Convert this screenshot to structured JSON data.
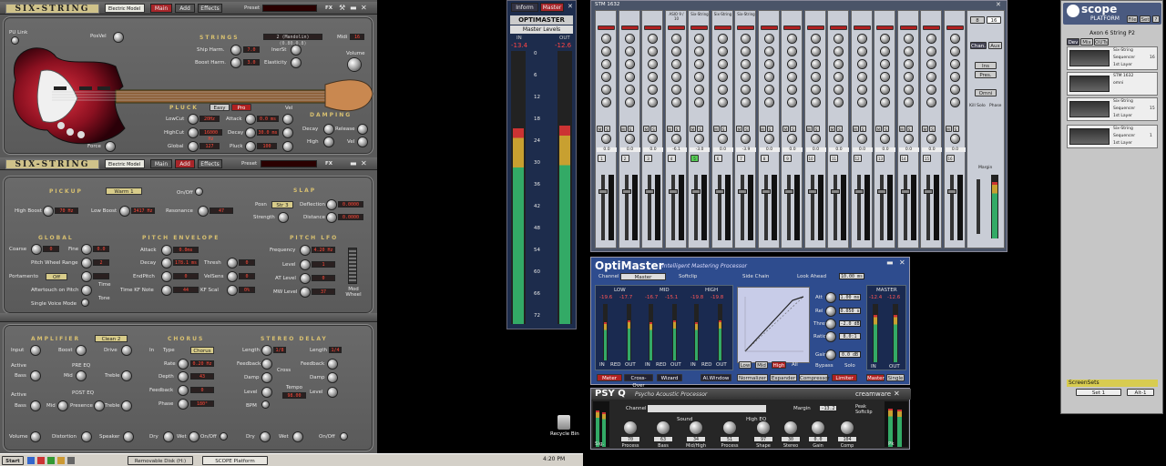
{
  "six": {
    "logo": "SIX-STRING",
    "preset_label": "Preset",
    "preset_name": "Electric Model",
    "tabs": [
      "Main",
      "Add",
      "Effects"
    ],
    "fx": "FX",
    "pu_link": "PU Link",
    "posvel": "PosVel",
    "strings_title": "STRINGS",
    "strings_preset": "2 (Mandolin) (0.80.0.8)",
    "midi": "Midi",
    "midi_val": "16",
    "ship_harm": "Ship Harm.",
    "ship_val": "7.0",
    "inertia": "InerSt",
    "boost_harm": "Boost Harm.",
    "boost_val": "3.0",
    "elasticity": "Elasticity",
    "volume": "Volume",
    "pluck_title": "PLUCK",
    "easy": "Easy",
    "pro": "Pro",
    "damping_title": "DAMPING",
    "vel": "Vel",
    "lowcut": "LowCut",
    "lowcut_val": "20Hz",
    "attack": "Attack",
    "attack_val": "0.0 ms",
    "decay": "Decay",
    "release": "Release",
    "highcut": "HighCut",
    "highcut_val": "16000 Hz",
    "decay2": "Decay",
    "decay2_val": "30.0 ms",
    "high": "High",
    "vel2": "Vel",
    "global": "Global",
    "global_val": "127",
    "pluck": "Pluck",
    "pluck_val": "100",
    "force": "Force"
  },
  "six2": {
    "preset_name": "Electric Model",
    "tabs": [
      "Main",
      "Add",
      "Effects"
    ],
    "preset_label": "Preset",
    "fx": "FX",
    "pickup": "PICKUP",
    "pickup_sel": "Warm 1",
    "onoff": "On/Off",
    "high_boost": "High Boost",
    "hb_val": "70 Hz",
    "low_boost": "Low Boost",
    "lb_val": "3417 Hz",
    "resonance": "Resonance",
    "res_val": "47",
    "slap": "SLAP",
    "posn": "Posn",
    "posn_sel": "Str 3",
    "deflection": "Deflection",
    "defl_val": "0.0000",
    "strength": "Strength",
    "distance": "Distance",
    "dist_val": "0.0000",
    "global": "GLOBAL",
    "coarse": "Coarse",
    "coarse_val": "0",
    "fine": "Fine",
    "fine_val": "0.0",
    "pitch_wheel": "Pitch Wheel Range",
    "pw_val": "2",
    "portamento": "Portamento",
    "porta_sel": "Off",
    "aftertouch": "Aftertouch on Pitch",
    "single_voice": "Single Voice Mode",
    "time": "Time",
    "tone": "Tone",
    "penv": "PITCH ENVELOPE",
    "attack": "Attack",
    "attack_val": "0.0ms",
    "decay": "Decay",
    "decay_val": "178.1 ms",
    "endpitch": "EndPitch",
    "end_val": "0",
    "timekf": "Time KF Note",
    "timekf_val": "44",
    "thresh": "Thresh",
    "thresh_val": "0",
    "velsens": "VelSens",
    "velsens_val": "0",
    "kfscal": "KF Scal",
    "kfscal_val": "0%",
    "plfo": "PITCH LFO",
    "freq": "Frequency",
    "freq_val": "4.20 Hz",
    "level": "Level",
    "level_val": "1",
    "at_level": "AT Level",
    "at_val": "0",
    "mw_level": "MW Level",
    "mw_val": "37",
    "mod_wheel": "Mod Wheel"
  },
  "six3": {
    "amp": "AMPLIFIER",
    "amp_sel": "Clean 2",
    "input": "Input",
    "boost": "Boost",
    "drive": "Drive",
    "active": "Active",
    "pre_eq": "PRE EQ",
    "bass": "Bass",
    "mid": "Mid",
    "treble": "Treble",
    "post_eq": "POST EQ",
    "presence": "Presence",
    "volume": "Volume",
    "distortion": "Distortion",
    "speaker": "Speaker",
    "chorus": "CHORUS",
    "in": "In",
    "type": "Type",
    "type_sel": "Chorus",
    "rate": "Rate",
    "rate_val": "0.20 Hz",
    "depth": "Depth",
    "depth_val": "43",
    "feedback": "Feedback",
    "fb_val": "0",
    "phase": "Phase",
    "phase_val": "180°",
    "dry": "Dry",
    "wet": "Wet",
    "onoff": "On/Off",
    "delay": "STEREO DELAY",
    "length": "Length",
    "len_val": "1/8",
    "length2": "Length",
    "len2_val": "1/4",
    "cross": "Cross",
    "fb": "Feedback",
    "fb2": "Feedback",
    "damp": "Damp",
    "damp2": "Damp",
    "lvl": "Level",
    "lvl2": "Level",
    "tempo": "Tempo",
    "tempo_val": "98.00",
    "bpm": "BPM"
  },
  "opti": {
    "tabs": [
      "Inform",
      "Master"
    ],
    "title": "OPTIMASTER",
    "sub": "Master Levels",
    "in": "IN",
    "out": "OUT",
    "in_val": "-13.4",
    "out_val": "-12.6",
    "scale": [
      "0",
      "6",
      "12",
      "18",
      "24",
      "30",
      "36",
      "42",
      "48",
      "54",
      "60",
      "66",
      "72"
    ]
  },
  "stm": {
    "title": "STM 1632",
    "strips": [
      {
        "name": "",
        "num": "1",
        "val": "0.0"
      },
      {
        "name": "",
        "num": "2",
        "val": "0.0"
      },
      {
        "name": "",
        "num": "3",
        "val": "0.0"
      },
      {
        "name": "ASIO 9 / 10",
        "num": "4",
        "val": "-6.1"
      },
      {
        "name": "Six-String",
        "num": "5",
        "val": "-3.0"
      },
      {
        "name": "Six-String",
        "num": "6",
        "val": "0.0"
      },
      {
        "name": "Six-String",
        "num": "7",
        "val": "-3.9"
      },
      {
        "name": "",
        "num": "8",
        "val": "0.0"
      },
      {
        "name": "",
        "num": "9",
        "val": "0.0"
      },
      {
        "name": "",
        "num": "10",
        "val": "0.0"
      },
      {
        "name": "",
        "num": "11",
        "val": "0.0"
      },
      {
        "name": "",
        "num": "12",
        "val": "0.0"
      },
      {
        "name": "",
        "num": "13",
        "val": "0.0"
      },
      {
        "name": "",
        "num": "14",
        "val": "0.0"
      },
      {
        "name": "",
        "num": "15",
        "val": "0.0"
      },
      {
        "name": "",
        "num": "16",
        "val": "0.0"
      }
    ],
    "aux": "Aux",
    "chan": "Chan.",
    "ins": "Ins",
    "pres": "Pres.",
    "omni": "Omni",
    "kill_solo": "Kill Solo",
    "phase": "Phase",
    "margin": "Margin",
    "buses": [
      "8",
      "16"
    ],
    "aux_vals": [
      "1",
      "2",
      "3",
      "4",
      "5",
      "6",
      "7",
      "8"
    ]
  },
  "proc": {
    "title": "OptiMaster",
    "subtitle": "Intelligent Mastering Processor",
    "channel": "Channel",
    "channel_sel": "Master",
    "softclip": "Softclip",
    "side_chain": "Side Chain",
    "look_ahead": "Look Ahead",
    "la_val": "10.00 ms",
    "bands": [
      {
        "name": "LOW",
        "l": "-19.6",
        "r": "-17.7"
      },
      {
        "name": "MID",
        "l": "-16.7",
        "r": "-15.1"
      },
      {
        "name": "HIGH",
        "l": "-19.8",
        "r": "-19.8"
      }
    ],
    "red": "RED",
    "out_lbl": "OUT",
    "in_lbl": "IN",
    "att": "Att",
    "att_val": "1.00 ms",
    "rel": "Rel",
    "rel_val": "0.050 s",
    "thres": "Thres",
    "thres_val": "-2.0 dB",
    "ratio": "Ratio",
    "ratio_val": "8.0:1",
    "gain": "Gain",
    "gain_val": "0.0 dB",
    "bypass": "Bypass",
    "solo": "Solo",
    "master": "MASTER",
    "m_l": "-12.4",
    "m_r": "-12.6",
    "low": "Low",
    "mid": "Mid",
    "high": "High",
    "all": "All",
    "tabs": [
      "Meter",
      "Cross-Over",
      "Wizard",
      "Al.Window"
    ],
    "proc_tabs": [
      "Normalizer",
      "Expander",
      "Compressor",
      "Limiter"
    ],
    "mst_tabs": [
      "Master",
      "Single"
    ]
  },
  "psyq": {
    "title": "PSY Q",
    "subtitle": "Psycho Acoustic Processor",
    "brand": "creamware",
    "channel": "Channel",
    "margin": "Margin",
    "margin_val": "-13.2",
    "peak": "Peak Softclip",
    "knobs": [
      {
        "label": "Process",
        "val": "70"
      },
      {
        "label": "Bass",
        "val": "63"
      },
      {
        "label": "Mid/High",
        "val": "34"
      },
      {
        "label": "Process",
        "val": "51"
      },
      {
        "label": "Shape",
        "val": "97"
      },
      {
        "label": "Stereo",
        "val": "30"
      },
      {
        "label": "Gain",
        "val": "0.0"
      },
      {
        "label": "Comp",
        "val": "104"
      }
    ],
    "sound": "Sound",
    "highmid": "High EQ",
    "sig": "Sig.",
    "pk": "Pk"
  },
  "scope": {
    "logo": "scope",
    "sub": "PLATFORM",
    "file": "File",
    "set": "Set",
    "help": "?",
    "project": "Axon 6 String P2",
    "tabs": [
      "Dev",
      "Mix",
      "OUTs"
    ],
    "items": [
      {
        "name": "Six-String",
        "sub": "Sequencer",
        "sub_val": "16",
        "extra": "1st Layer"
      },
      {
        "name": "STM 1632",
        "sub": "omni",
        "sub_val": "",
        "extra": ""
      },
      {
        "name": "Six-String",
        "sub": "Sequencer",
        "sub_val": "15",
        "extra": "1st Layer"
      },
      {
        "name": "Six-String",
        "sub": "Sequencer",
        "sub_val": "1",
        "extra": "1st Layer"
      }
    ],
    "screensets": "ScreenSets",
    "set1": "Set 1",
    "alt": "Alt-1"
  },
  "desktop": {
    "recycle": "Recycle Bin"
  },
  "taskbar": {
    "start": "Start",
    "items": [
      "Removable Disk (H:)",
      "SCOPE Platform"
    ],
    "time": "4:20 PM"
  }
}
